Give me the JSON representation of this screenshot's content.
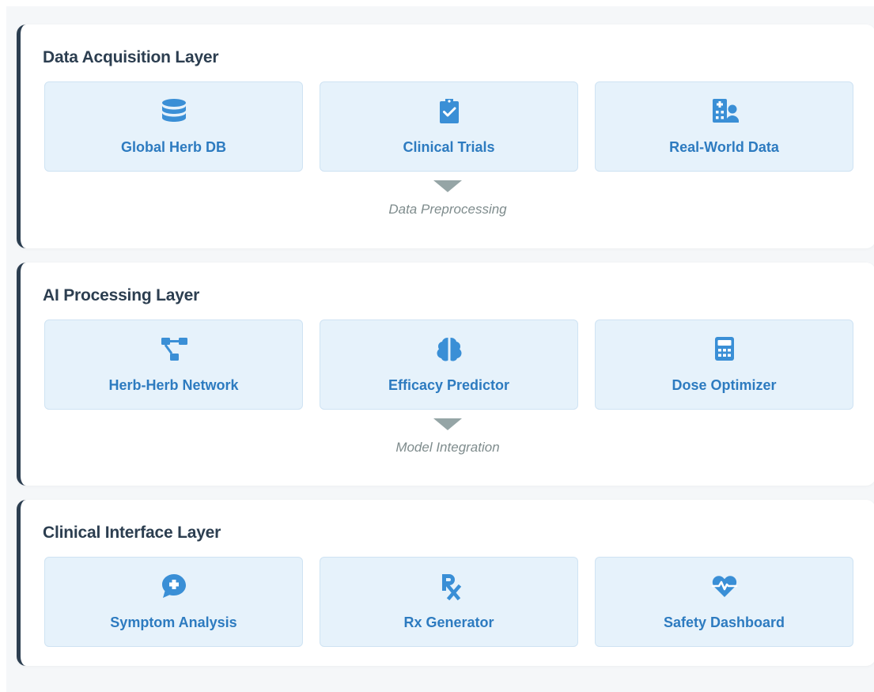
{
  "layers": [
    {
      "title": "Data Acquisition Layer",
      "modules": [
        {
          "label": "Global Herb DB",
          "icon": "database-icon"
        },
        {
          "label": "Clinical Trials",
          "icon": "clipboard-check-icon"
        },
        {
          "label": "Real-World Data",
          "icon": "hospital-user-icon"
        }
      ],
      "connector": "Data Preprocessing"
    },
    {
      "title": "AI Processing Layer",
      "modules": [
        {
          "label": "Herb-Herb Network",
          "icon": "network-icon"
        },
        {
          "label": "Efficacy Predictor",
          "icon": "brain-icon"
        },
        {
          "label": "Dose Optimizer",
          "icon": "calculator-icon"
        }
      ],
      "connector": "Model Integration"
    },
    {
      "title": "Clinical Interface Layer",
      "modules": [
        {
          "label": "Symptom Analysis",
          "icon": "comment-medical-icon"
        },
        {
          "label": "Rx Generator",
          "icon": "prescription-icon"
        },
        {
          "label": "Safety Dashboard",
          "icon": "heart-pulse-icon"
        }
      ]
    }
  ],
  "colors": {
    "accent_border": "#2c3e50",
    "module_bg": "#e6f2fb",
    "module_text": "#2d7bc0",
    "icon": "#3a8fd6",
    "arrow": "#95a5a6",
    "connector_text": "#7f8c8d"
  }
}
